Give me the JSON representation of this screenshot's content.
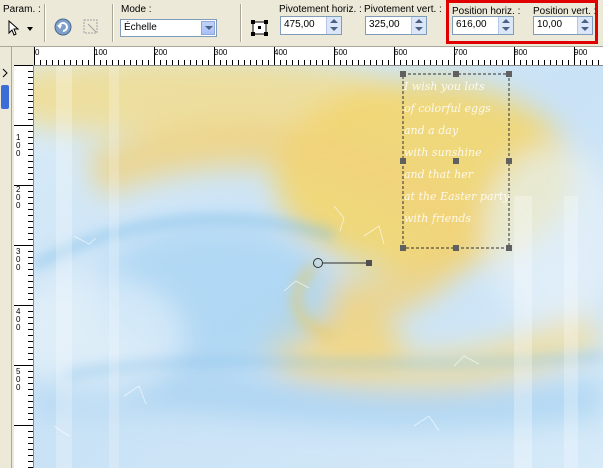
{
  "toolbar": {
    "param_label": "Param. :",
    "mode_label": "Mode :",
    "mode_value": "Échelle",
    "pivot_h_label": "Pivotement horiz. :",
    "pivot_h_value": "475,00",
    "pivot_v_label": "Pivotement vert. :",
    "pivot_v_value": "325,00",
    "pos_h_label": "Position horiz. :",
    "pos_h_value": "616,00",
    "pos_v_label": "Position vert. :",
    "pos_v_value": "10,00"
  },
  "rulers": {
    "horizontal": [
      "0",
      "100",
      "200",
      "300",
      "400",
      "500",
      "600",
      "700",
      "800",
      "900"
    ],
    "vertical": [
      "100",
      "200",
      "300",
      "400",
      "500"
    ]
  },
  "canvas_text": [
    "I wish you lots",
    "of colorful eggs",
    "and a day",
    "with sunshine",
    "and that her",
    "at the Easter party",
    "with friends"
  ],
  "colors": {
    "highlight": "#e00000",
    "selection_handle": "#606060"
  }
}
